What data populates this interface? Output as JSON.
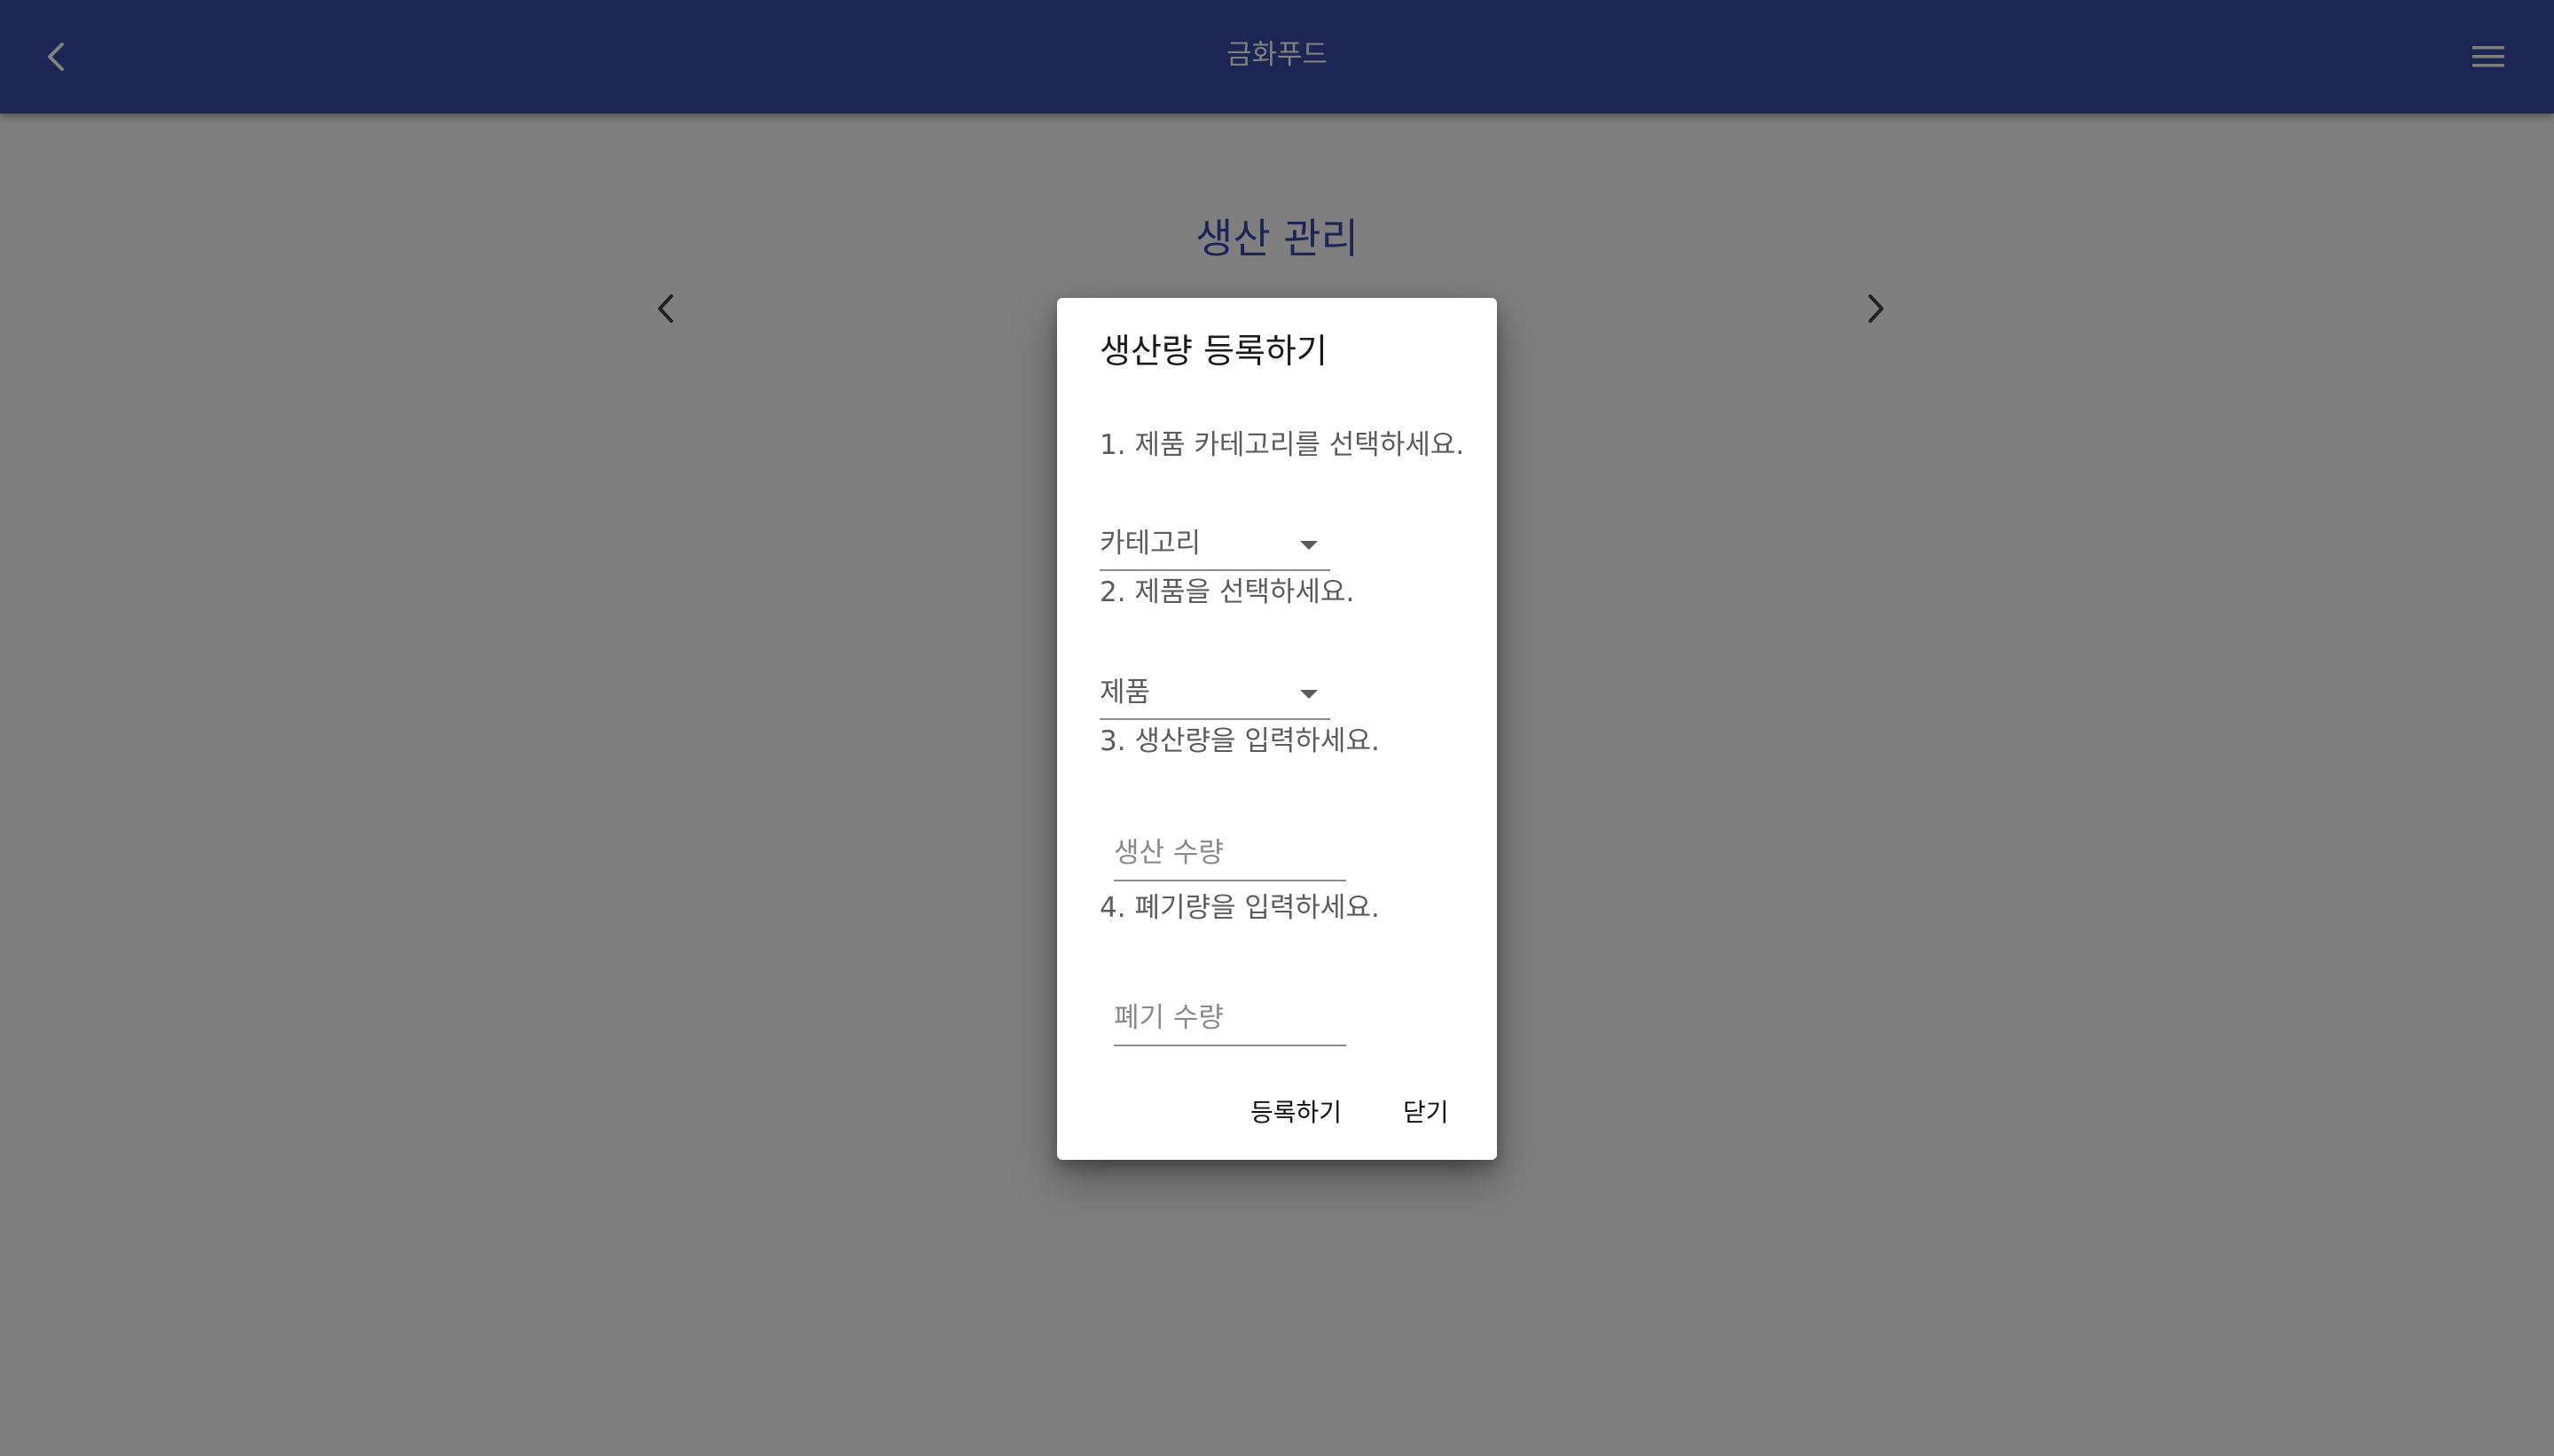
{
  "app": {
    "title": "금화푸드",
    "bar_color": "#3a4aaa"
  },
  "page": {
    "title": "생산 관리"
  },
  "dialog": {
    "title": "생산량 등록하기",
    "step1_label": "1. 제품 카테고리를 선택하세요.",
    "category_select": {
      "selected": "카테고리"
    },
    "step2_label": "2. 제품을 선택하세요.",
    "product_select": {
      "selected": "제품"
    },
    "step3_label": "3. 생산량을 입력하세요.",
    "production_input": {
      "placeholder": "생산 수량"
    },
    "step4_label": "4. 폐기량을 입력하세요.",
    "waste_input": {
      "placeholder": "폐기 수량"
    },
    "register_label": "등록하기",
    "close_label": "닫기"
  },
  "icons": {
    "back": "chevron-left-icon",
    "menu": "hamburger-menu-icon",
    "prev": "chevron-left-icon",
    "next": "chevron-right-icon",
    "dropdown": "caret-down-icon"
  }
}
